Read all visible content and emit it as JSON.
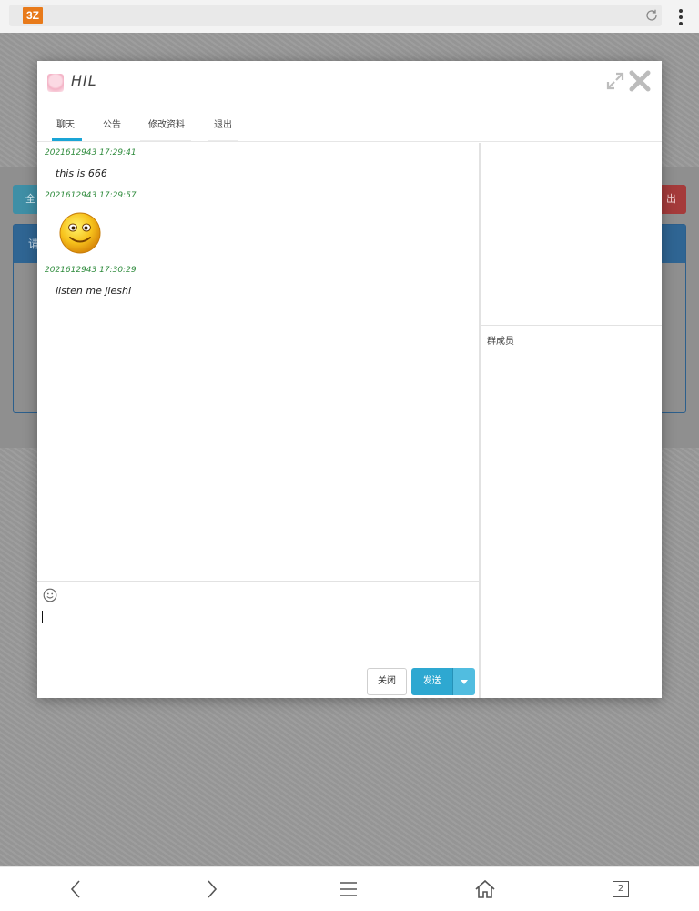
{
  "browser": {
    "logo_text": "3Z"
  },
  "background": {
    "left_button_partial": "全",
    "right_button_partial": "出",
    "panel_head_partial": "请"
  },
  "dialog": {
    "title": "HIL",
    "tabs": [
      {
        "label": "聊天",
        "active": true
      },
      {
        "label": "公告",
        "active": false
      },
      {
        "label": "修改资料",
        "active": false
      },
      {
        "label": "退出",
        "active": false
      }
    ],
    "messages": [
      {
        "time": "2021612943 17:29:41",
        "text": "this is 666"
      },
      {
        "time": "2021612943 17:29:57",
        "emoji": "smiley-face"
      },
      {
        "time": "2021612943 17:30:29",
        "text": "listen me jieshi"
      }
    ],
    "members_label": "群成员",
    "close_button": "关闭",
    "send_button": "发送"
  },
  "colors": {
    "accent": "#2ea8d1",
    "timestamp": "#2e8b3c",
    "logo": "#e87a1a"
  },
  "bottom_nav": {
    "tab_count": "2"
  }
}
